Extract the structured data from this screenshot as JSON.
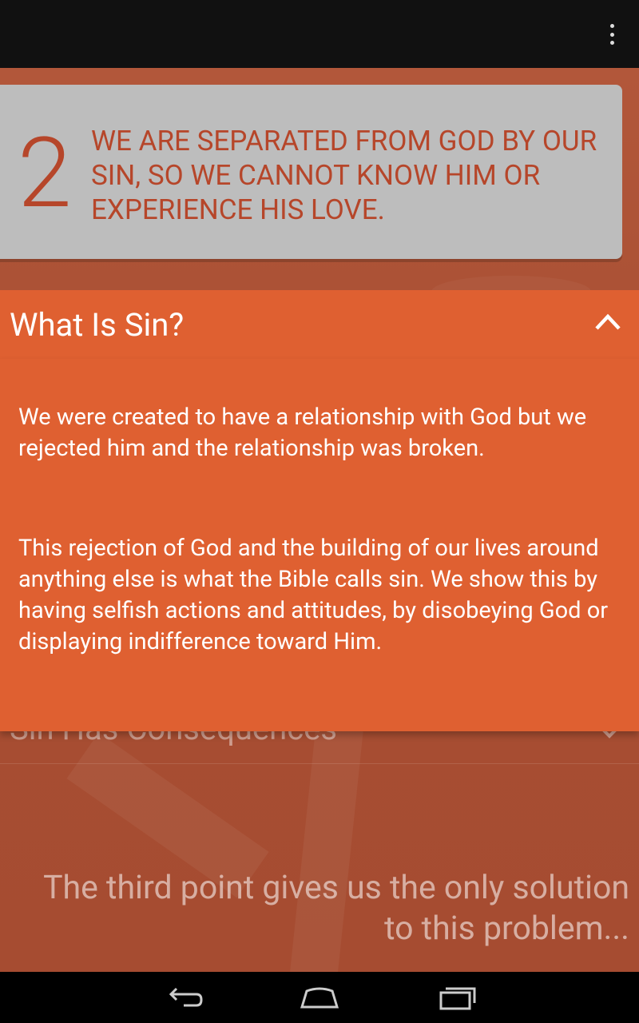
{
  "status_bar": {
    "menu_icon": "overflow-menu-icon"
  },
  "point_card": {
    "number": "2",
    "text": "WE ARE SEPARATED FROM GOD BY OUR SIN, SO WE CANNOT KNOW HIM OR EXPERIENCE HIS LOVE."
  },
  "accordion": {
    "expanded": {
      "title": "What Is Sin?",
      "toggle_icon": "chevron-up-icon",
      "paragraphs": [
        "We were created to have a relationship with God but we rejected him and the relationship was broken.",
        "This rejection of God and the building of our lives around anything else is what the Bible calls sin. We show this by having selfish actions and attitudes, by disobeying God or displaying indifference toward Him."
      ]
    },
    "collapsed": {
      "title": "Sin Has Consequences",
      "toggle_icon": "chevron-down-icon"
    }
  },
  "footer": {
    "text": "The third point gives us the only solution to this problem..."
  },
  "nav_bar": {
    "back_icon": "back-icon",
    "home_icon": "home-icon",
    "recent_icon": "recent-apps-icon"
  },
  "colors": {
    "accent": "#df6031",
    "card_bg": "#bdbdbd",
    "card_text": "#b6462a",
    "page_bg": "#a84f33"
  }
}
